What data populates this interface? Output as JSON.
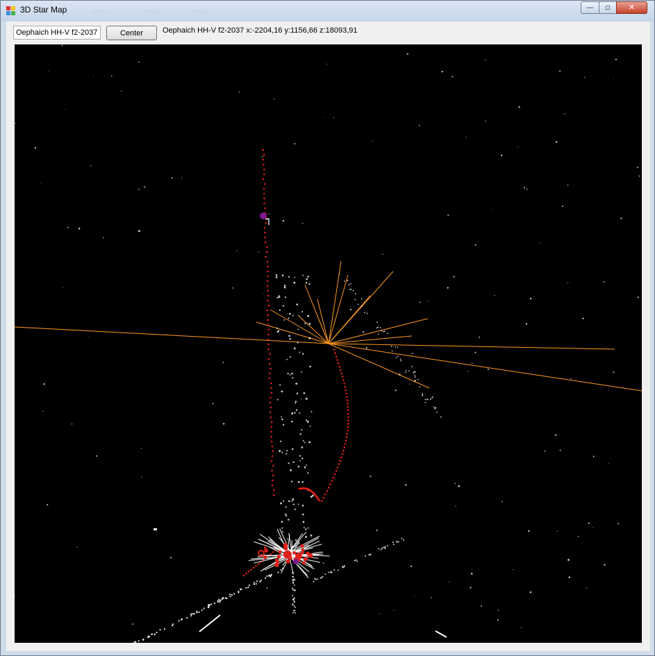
{
  "window": {
    "title": "3D Star Map",
    "blurred_menu": [
      "..........",
      ".........",
      "........"
    ],
    "buttons": {
      "minimize": "—",
      "maximize": "▫",
      "close": "✕"
    }
  },
  "toolbar": {
    "search_value": "Oephaich HH-V f2-2037",
    "center_label": "Center",
    "coords_text": "Oephaich HH-V f2-2037 x:-2204,16 y:1156,66 z:18093,91"
  },
  "colors": {
    "viewport_bg": "#000000",
    "route_red": "#e0201a",
    "ray_orange": "#ff9a1f",
    "star_white": "#ffffff",
    "marker_purple": "#7a1a8c"
  }
}
